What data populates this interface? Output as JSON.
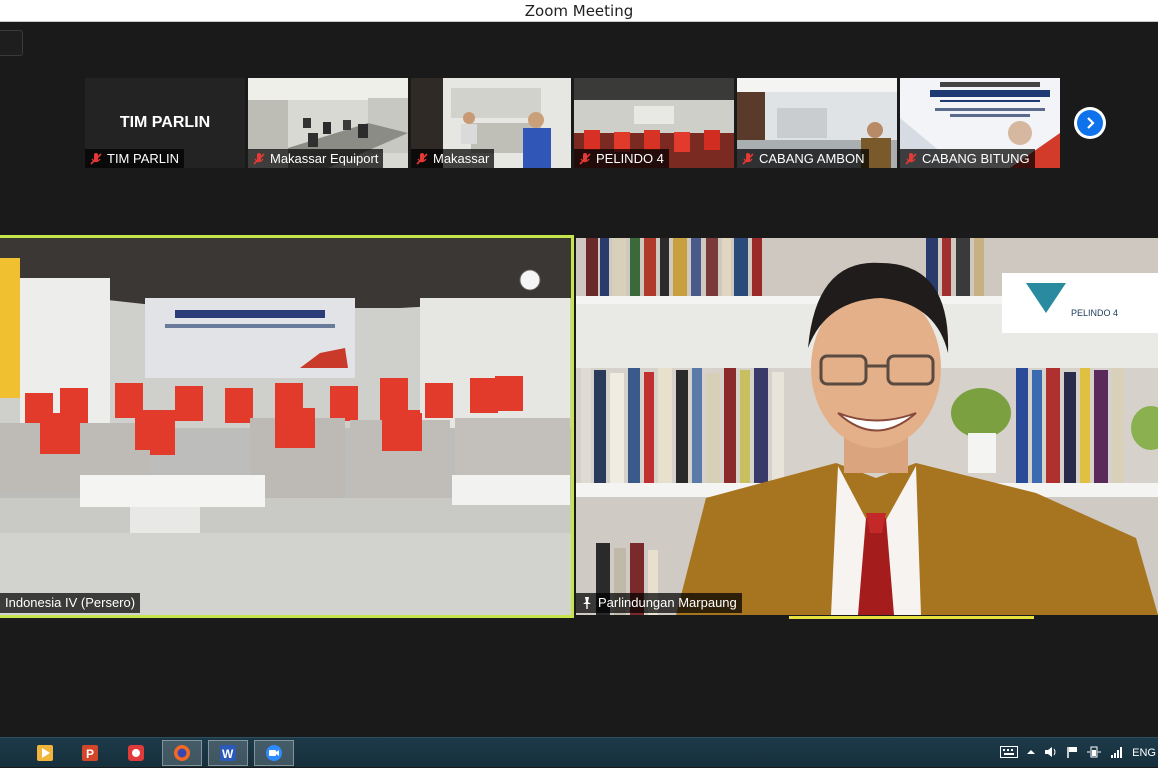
{
  "window": {
    "title": "Zoom Meeting"
  },
  "thumbnails": [
    {
      "name": "TIM PARLIN",
      "big_name": "TIM PARLIN",
      "muted": true
    },
    {
      "name": "Makassar Equiport",
      "muted": true
    },
    {
      "name": "Makassar",
      "muted": true
    },
    {
      "name": "PELINDO 4",
      "muted": true
    },
    {
      "name": "CABANG AMBON",
      "muted": true
    },
    {
      "name": "CABANG BITUNG",
      "muted": true
    }
  ],
  "next_button": {
    "icon": "chevron-right-icon"
  },
  "main_tiles": {
    "left": {
      "name": "Indonesia IV (Persero)",
      "active_speaker": true
    },
    "right": {
      "name": "Parlindungan Marpaung",
      "pinned": true
    }
  },
  "taskbar": {
    "apps": [
      "windows-media-icon",
      "powerpoint-icon",
      "screen-recorder-icon",
      "firefox-icon",
      "word-icon",
      "zoom-icon"
    ],
    "tray_lang": "ENG"
  },
  "colors": {
    "zoom_blue": "#0e72ed",
    "speaker_highlight": "#c6e44b",
    "muted_red": "#e53935"
  }
}
